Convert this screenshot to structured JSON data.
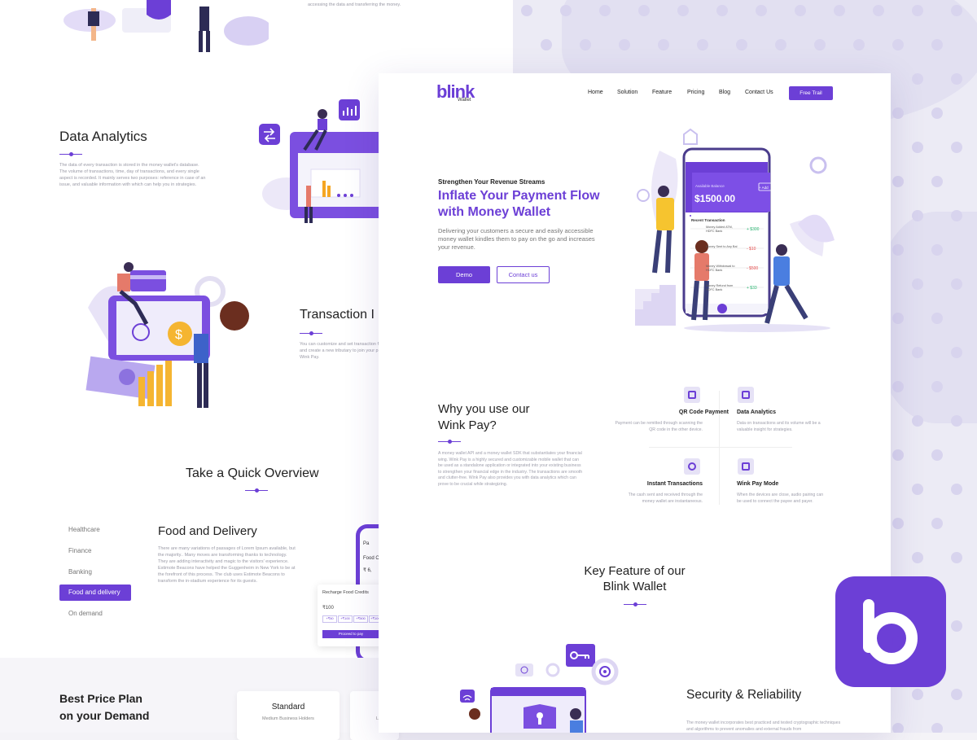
{
  "background_page": {
    "data_analytics": {
      "title": "Data Analytics",
      "description": "The data of every transaction is stored in the money wallet's database. The volume of transactions, time, day of transactions, and every single aspect is recorded. It mainly serves two purposes: reference in case of an issue, and valuable information with which can help you in strategies."
    },
    "top_text": "accessing the data and transferring the money.",
    "transaction": {
      "title": "Transaction I",
      "description": "You can customize and set transaction f and create a new tributary to join your p Wink Pay."
    },
    "overview": {
      "title": "Take a Quick Overview"
    },
    "categories": [
      "Healthcare",
      "Finance",
      "Banking",
      "Food and delivery",
      "On demand"
    ],
    "food": {
      "title": "Food and Delivery",
      "description": "There are many variations of passages of Lorem Ipsum available, but the majority.. Many moves are transforming thanks to technology. They are adding interactivity and magic to the visitors' experience. Estimote Beacons have helped the Guggenheim in New York to be at the forefront of this process. The club uses Estimote Beacons to transform the in-stadium experience for its guests."
    },
    "phone_mock": {
      "header": "Recharge Food Credits",
      "amount": "₹100",
      "chips": [
        "+₹50",
        "+₹100",
        "+₹500",
        "+₹1000"
      ],
      "pay_button": "Proceed to pay",
      "tab_label": "Pa",
      "line1": "Food C",
      "line2": "₹ 6,"
    },
    "price": {
      "title_line1": "Best Price Plan",
      "title_line2": "on your Demand",
      "card_title": "Standard",
      "card_sub": "Medium Business Holders",
      "card2_letter": "L"
    }
  },
  "main_page": {
    "brand": {
      "logo": "blink",
      "sub": "Wallet"
    },
    "nav": [
      "Home",
      "Solution",
      "Feature",
      "Pricing",
      "Blog",
      "Contact Us"
    ],
    "cta_free": "Free Trail",
    "hero": {
      "eyebrow": "Strengthen Your Revenue Streams",
      "title_line1": "Inflate Your Payment Flow",
      "title_line2": "with Money Wallet",
      "body": "Delivering your customers a secure and easily accessible money wallet kindles them to pay on the go and increases your revenue.",
      "btn_demo": "Demo",
      "btn_contact": "Contact us"
    },
    "phone": {
      "balance_label": "Available Balance",
      "balance": "$1500.00",
      "add": "+ Add",
      "recent": "Recent Transaction",
      "rows": [
        {
          "label": "Money Added ATM, HDFC Bank",
          "amount": "+ $300",
          "color": "#2bb673"
        },
        {
          "label": "Money Sent to Any Bal",
          "amount": "- $10",
          "color": "#e54b4b"
        },
        {
          "label": "Money Withdrawal to HDFC Bank",
          "amount": "- $500",
          "color": "#e54b4b"
        },
        {
          "label": "Money Refund from HDFC Bank",
          "amount": "+ $33",
          "color": "#2bb673"
        }
      ]
    },
    "why": {
      "title_line1": "Why you use our",
      "title_line2": "Wink Pay?",
      "body": "A money wallet API and a money wallet SDK that substantiates your financial wing. Wink Pay is a highly secured and customizable mobile wallet that can be used as a standalone application or integrated into your existing business to strengthen your financial edge in the industry. The transactions are smooth and clutter-free. Wink Pay also provides you with data analytics which can prove to be crucial while strategizing."
    },
    "features": [
      {
        "title": "QR Code Payment",
        "desc": "Payment can be remitted through scanning the QR code in the other device.",
        "icon": "qr-code-icon"
      },
      {
        "title": "Data Analytics",
        "desc": "Data on transactions and its volume will be a valuable insight for strategies.",
        "icon": "analytics-chart-icon"
      },
      {
        "title": "Instant Transactions",
        "desc": "The cash sent and received through the money wallet are instantaneous.",
        "icon": "instant-dollar-icon"
      },
      {
        "title": "Wink Pay Mode",
        "desc": "When the devices are close, audio pairing can be used to connect the payee and payer.",
        "icon": "pay-mode-icon"
      }
    ],
    "key_feature": {
      "title_line1": "Key Feature of our",
      "title_line2": "Blink Wallet"
    },
    "security": {
      "title": "Security & Reliability",
      "body": "The money wallet incorporates best practiced and tested cryptographic techniques and algorithms to prevent anomalies and external frauds from"
    }
  },
  "colors": {
    "accent": "#6c3fd6",
    "accent_light": "#e6e2f6",
    "bg": "#ecebf5"
  }
}
